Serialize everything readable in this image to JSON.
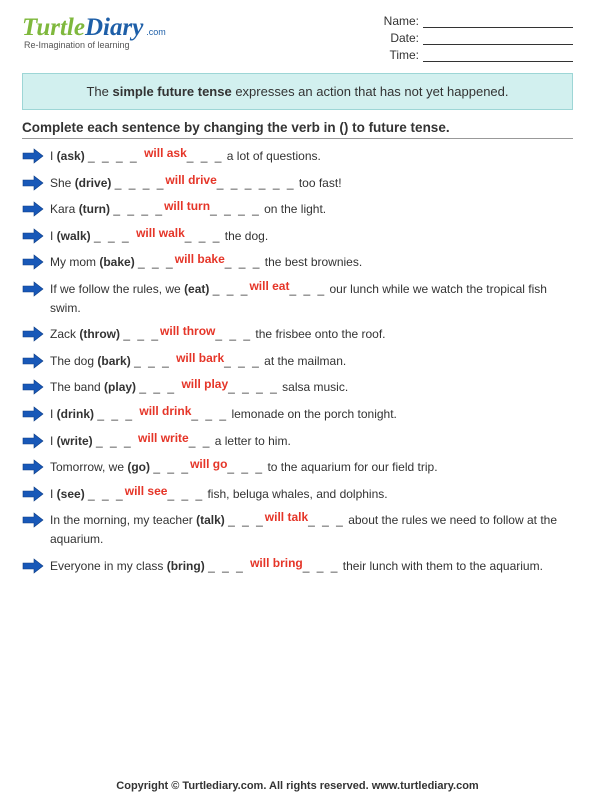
{
  "header": {
    "logo": {
      "turtle": "Turtle",
      "diary": "Diary",
      "dotcom": ".com",
      "tagline": "Re-Imagination of learning"
    },
    "fields": {
      "name": "Name:",
      "date": "Date:",
      "time": "Time:"
    }
  },
  "tip": {
    "pre": "The ",
    "bold": "simple future tense",
    "post": " expresses an action that has not yet happened."
  },
  "instruction": "Complete each sentence by changing the verb in () to future tense.",
  "items": [
    {
      "pre": "I ",
      "verb": "(ask)",
      "blank1": "_ _ _ _ ",
      "ans": "will ask",
      "blank2": "_ _ _",
      "post": " a lot of questions."
    },
    {
      "pre": "She ",
      "verb": "(drive)",
      "blank1": "_ _ _ _",
      "ans": "will drive",
      "blank2": "_ _ _ _ _ _",
      "post": " too fast!"
    },
    {
      "pre": "Kara ",
      "verb": "(turn)",
      "blank1": "_ _ _ _",
      "ans": "will turn",
      "blank2": "_ _ _ _",
      "post": " on the light."
    },
    {
      "pre": "I ",
      "verb": "(walk)",
      "blank1": "_ _ _ ",
      "ans": "will walk",
      "blank2": "_ _ _",
      "post": " the dog."
    },
    {
      "pre": "My mom ",
      "verb": "(bake)",
      "blank1": "_ _ _",
      "ans": "will bake",
      "blank2": "_ _ _",
      "post": " the best brownies."
    },
    {
      "pre": "If we follow the rules, we ",
      "verb": "(eat)",
      "blank1": "_ _ _",
      "ans": "will eat",
      "blank2": "_ _ _",
      "post": " our lunch while we watch the tropical fish swim."
    },
    {
      "pre": "Zack ",
      "verb": "(throw)",
      "blank1": "_ _ _",
      "ans": "will throw",
      "blank2": "_ _ _",
      "post": " the frisbee onto the roof."
    },
    {
      "pre": "The dog ",
      "verb": "(bark)",
      "blank1": "_ _ _ ",
      "ans": "will bark",
      "blank2": "_ _ _",
      "post": " at the mailman."
    },
    {
      "pre": "The band ",
      "verb": "(play)",
      "blank1": "_ _ _ ",
      "ans": "will play",
      "blank2": "_ _ _ _",
      "post": " salsa music."
    },
    {
      "pre": "I ",
      "verb": "(drink)",
      "blank1": "_ _ _ ",
      "ans": "will drink",
      "blank2": "_ _ _",
      "post": " lemonade on the porch tonight."
    },
    {
      "pre": "I ",
      "verb": "(write)",
      "blank1": "_ _ _ ",
      "ans": "will write",
      "blank2": "_ _",
      "post": " a letter to him."
    },
    {
      "pre": "Tomorrow, we ",
      "verb": "(go)",
      "blank1": "_ _ _",
      "ans": "will go",
      "blank2": "_ _ _",
      "post": " to the aquarium for our field trip."
    },
    {
      "pre": "I ",
      "verb": "(see)",
      "blank1": "_ _ _",
      "ans": "will see",
      "blank2": "_ _ _",
      "post": " fish, beluga whales, and dolphins."
    },
    {
      "pre": "In the morning, my teacher ",
      "verb": "(talk)",
      "blank1": "_ _ _",
      "ans": "will talk",
      "blank2": "_ _ _",
      "post": " about the rules we need to follow at the aquarium."
    },
    {
      "pre": "Everyone in my class ",
      "verb": "(bring)",
      "blank1": "_ _ _ ",
      "ans": "will bring",
      "blank2": "_ _ _",
      "post": " their lunch with them to the aquarium."
    }
  ],
  "footer": {
    "copyright": "Copyright © Turtlediary.com. All rights reserved. ",
    "url": "www.turtlediary.com"
  }
}
